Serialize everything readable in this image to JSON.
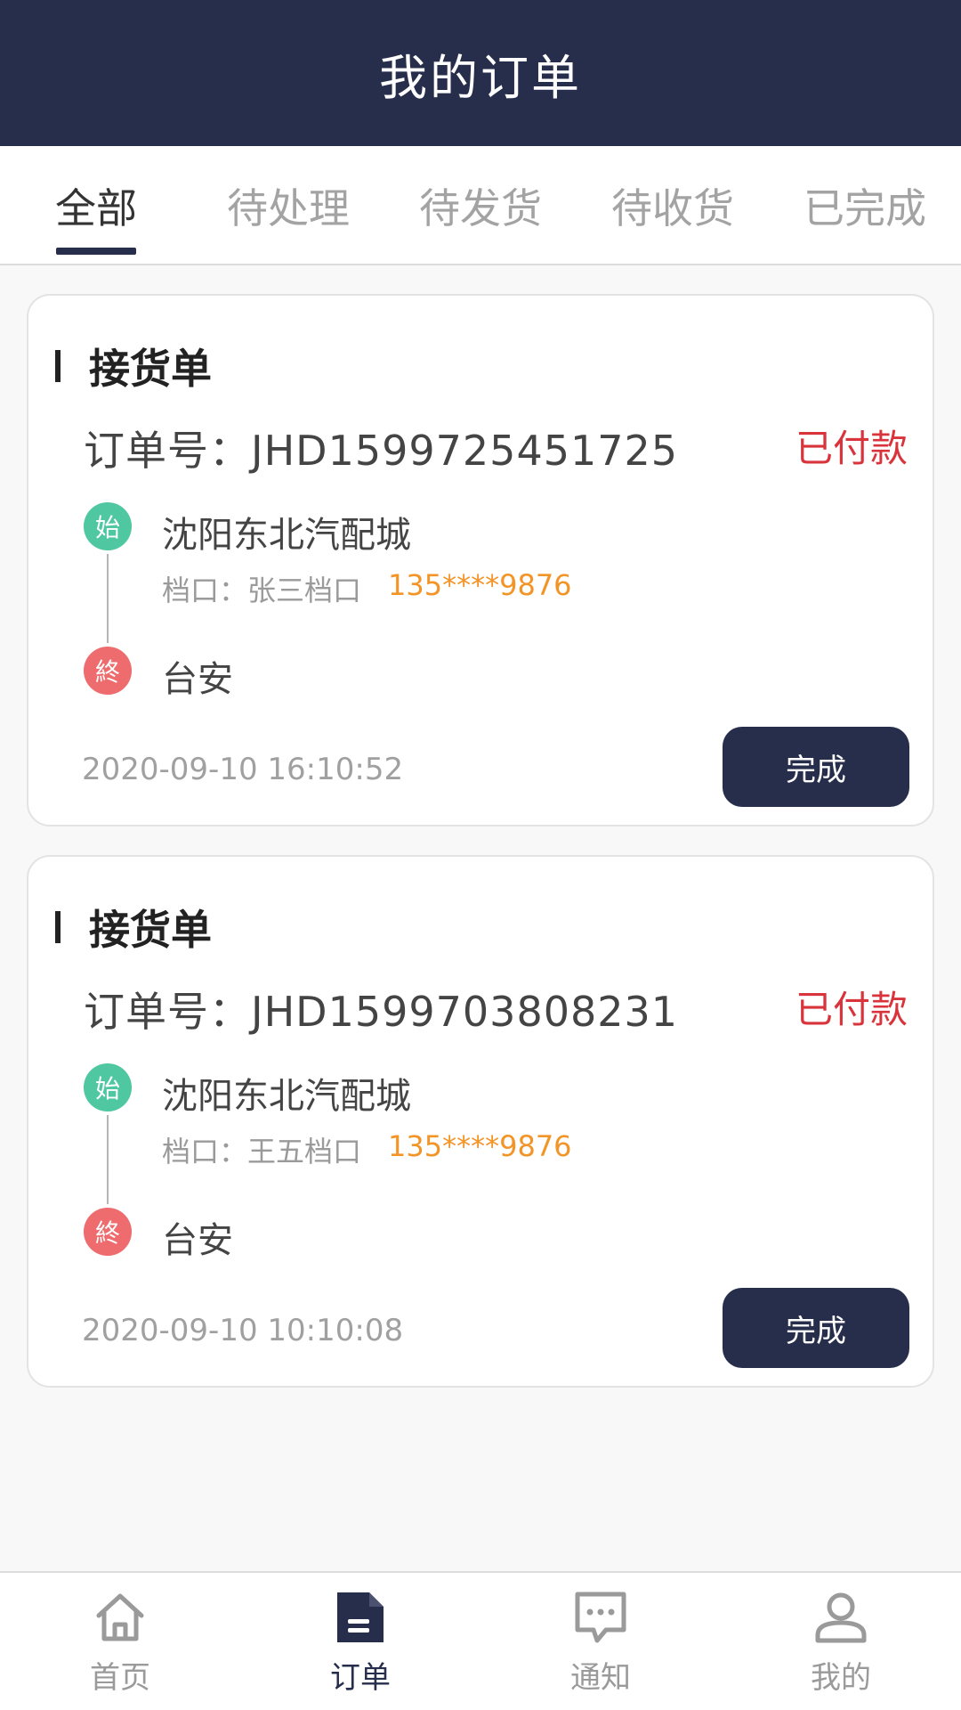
{
  "header": {
    "title": "我的订单"
  },
  "tabs": [
    {
      "label": "全部",
      "active": true
    },
    {
      "label": "待处理",
      "active": false
    },
    {
      "label": "待发货",
      "active": false
    },
    {
      "label": "待收货",
      "active": false
    },
    {
      "label": "已完成",
      "active": false
    }
  ],
  "orders": [
    {
      "type": "接货单",
      "order_label": "订单号：",
      "order_no": "JHD1599725451725",
      "status": "已付款",
      "start_badge": "始",
      "from": "沈阳东北汽配城",
      "stall": "档口：张三档口",
      "phone": "135****9876",
      "end_badge": "終",
      "to": "台安",
      "time": "2020-09-10 16:10:52",
      "button": "完成"
    },
    {
      "type": "接货单",
      "order_label": "订单号：",
      "order_no": "JHD1599703808231",
      "status": "已付款",
      "start_badge": "始",
      "from": "沈阳东北汽配城",
      "stall": "档口：王五档口",
      "phone": "135****9876",
      "end_badge": "終",
      "to": "台安",
      "time": "2020-09-10 10:10:08",
      "button": "完成"
    }
  ],
  "bottom_nav": [
    {
      "label": "首页",
      "icon": "home-icon",
      "active": false
    },
    {
      "label": "订单",
      "icon": "document-icon",
      "active": true
    },
    {
      "label": "通知",
      "icon": "message-icon",
      "active": false
    },
    {
      "label": "我的",
      "icon": "user-icon",
      "active": false
    }
  ],
  "colors": {
    "primary": "#272e4b",
    "paid": "#d9333b",
    "phone": "#f29426",
    "start": "#4fc7a0",
    "end": "#ee6b6e"
  }
}
